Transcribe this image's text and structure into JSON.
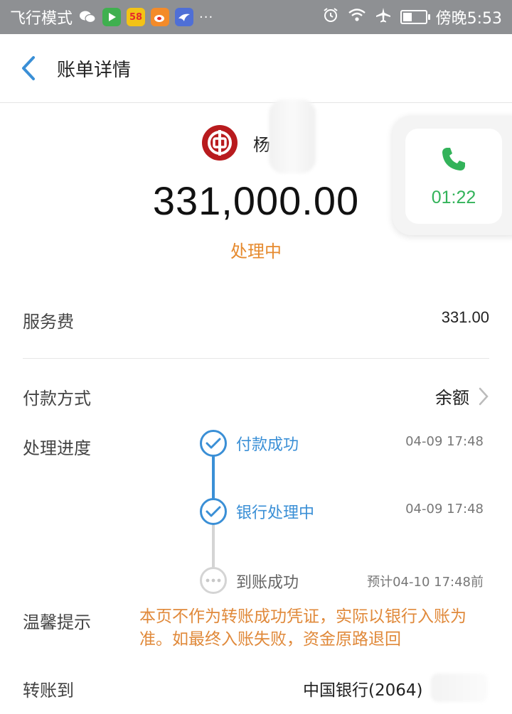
{
  "status_bar": {
    "left_text": "飞行模式",
    "apps": [
      "wechat-icon",
      "video-app-icon",
      "58-app-icon",
      "weibo-icon",
      "bird-app-icon"
    ],
    "app_58_label": "58",
    "more": "···",
    "right_text": "傍晚5:53"
  },
  "header": {
    "title": "账单详情"
  },
  "payee": {
    "name": "杨",
    "amount": "331,000.00",
    "status": "处理中"
  },
  "call_overlay": {
    "timer": "01:22"
  },
  "details": {
    "fee_label": "服务费",
    "fee_value": "331.00",
    "payment_method_label": "付款方式",
    "payment_method_value": "余额",
    "progress_label": "处理进度",
    "progress_steps": [
      {
        "label": "付款成功",
        "time": "04-09 17:48",
        "state": "done"
      },
      {
        "label": "银行处理中",
        "time": "04-09 17:48",
        "state": "done"
      },
      {
        "label": "到账成功",
        "time": "预计04-10 17:48前",
        "state": "pending"
      }
    ],
    "tip_label": "温馨提示",
    "tip_text": "本页不作为转账成功凭证，实际以银行入账为准。如最终入账失败，资金原路退回",
    "destination_label": "转账到",
    "destination_value": "中国银行(2064)"
  },
  "colors": {
    "accent_blue": "#3a8fd6",
    "status_orange": "#e68a2e",
    "call_green": "#33b35a",
    "bank_red": "#b81b1e"
  }
}
